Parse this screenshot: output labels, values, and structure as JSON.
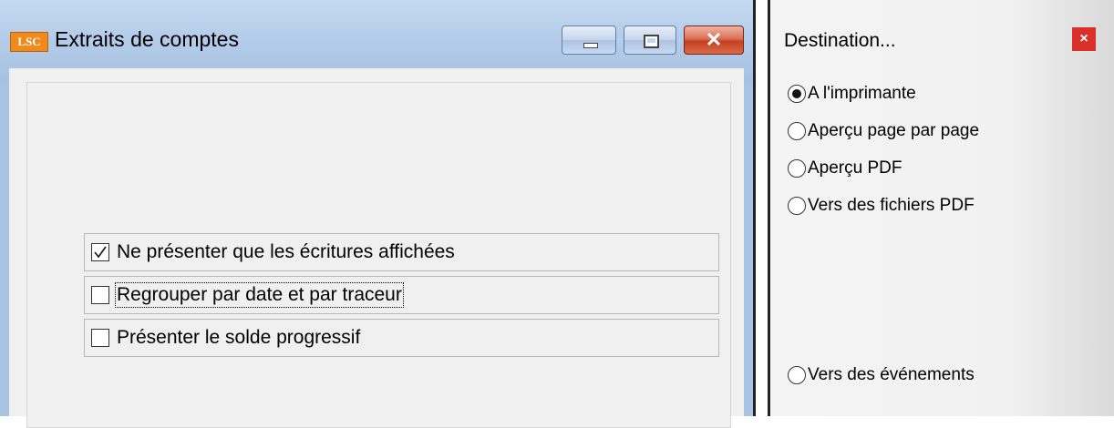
{
  "main_window": {
    "icon_text": "LSC",
    "title": "Extraits de comptes",
    "options": [
      {
        "label": "Ne présenter que les écritures affichées",
        "checked": true
      },
      {
        "label": "Regrouper par date et par traceur",
        "checked": false
      },
      {
        "label": "Présenter le solde progressif",
        "checked": false
      }
    ]
  },
  "destination_dialog": {
    "title": "Destination...",
    "close_label": "×",
    "options": [
      {
        "label": "A l'imprimante",
        "selected": true
      },
      {
        "label": "Aperçu page par page",
        "selected": false
      },
      {
        "label": "Aperçu PDF",
        "selected": false
      },
      {
        "label": "Vers des fichiers PDF",
        "selected": false
      },
      {
        "label": "Vers des événements",
        "selected": false
      }
    ]
  }
}
